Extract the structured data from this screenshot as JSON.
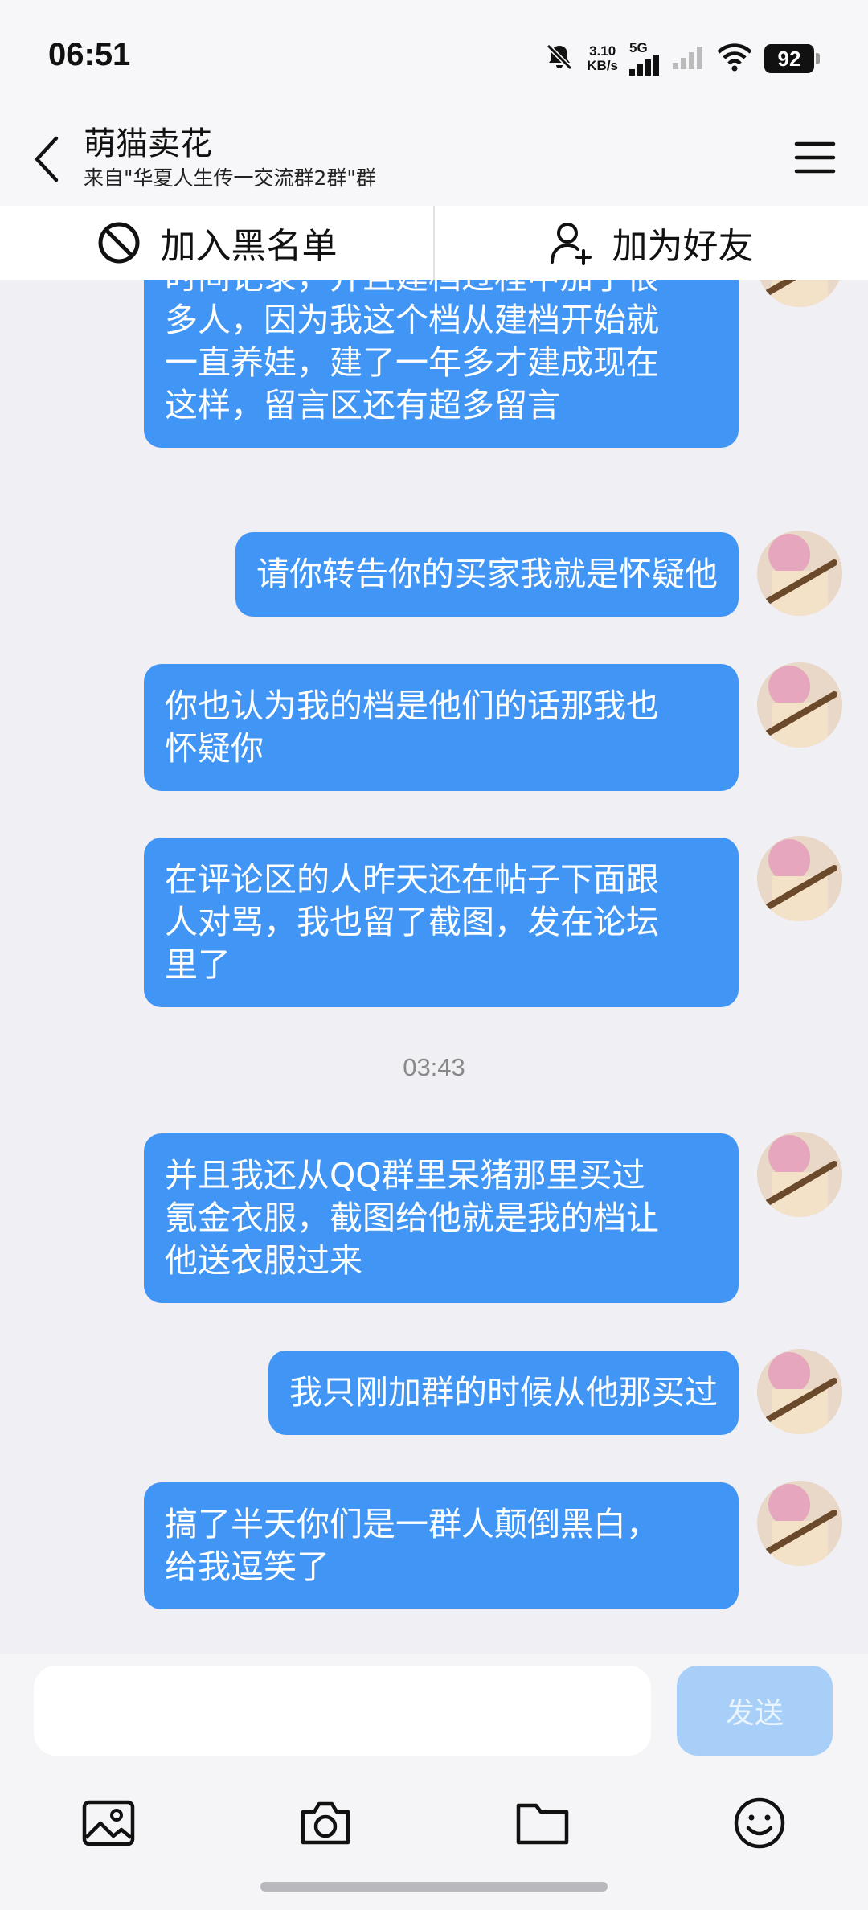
{
  "status_bar": {
    "time": "06:51",
    "net_speed_value": "3.10",
    "net_speed_unit": "KB/s",
    "network_type": "5G",
    "battery": "92"
  },
  "header": {
    "title": "萌猫卖花",
    "subtitle": "来自\"华夏人生传一交流群2群\"群"
  },
  "actions": {
    "blacklist_label": "加入黑名单",
    "add_friend_label": "加为好友"
  },
  "messages": [
    {
      "text": "我的档都是我自己画图做的，还有\n时间记录，并且建档过程中加了很\n多人，因为我这个档从建档开始就\n一直养娃，建了一年多才建成现在\n这样，留言区还有超多留言"
    },
    {
      "text": "请你转告你的买家我就是怀疑他"
    },
    {
      "text": "你也认为我的档是他们的话那我也\n怀疑你"
    },
    {
      "text": "在评论区的人昨天还在帖子下面跟\n人对骂，我也留了截图，发在论坛\n里了"
    },
    {
      "text": "并且我还从QQ群里呆猪那里买过\n氪金衣服，截图给他就是我的档让\n他送衣服过来"
    },
    {
      "text": "我只刚加群的时候从他那买过"
    },
    {
      "text": "搞了半天你们是一群人颠倒黑白，\n给我逗笑了"
    }
  ],
  "timestamp": "03:43",
  "input": {
    "placeholder": "",
    "send_label": "发送"
  },
  "colors": {
    "bubble": "#4196f5",
    "send_disabled": "#a8cff8",
    "background": "#efeff4"
  },
  "toolbar_icons": [
    "image-icon",
    "camera-icon",
    "folder-icon",
    "emoji-icon"
  ]
}
